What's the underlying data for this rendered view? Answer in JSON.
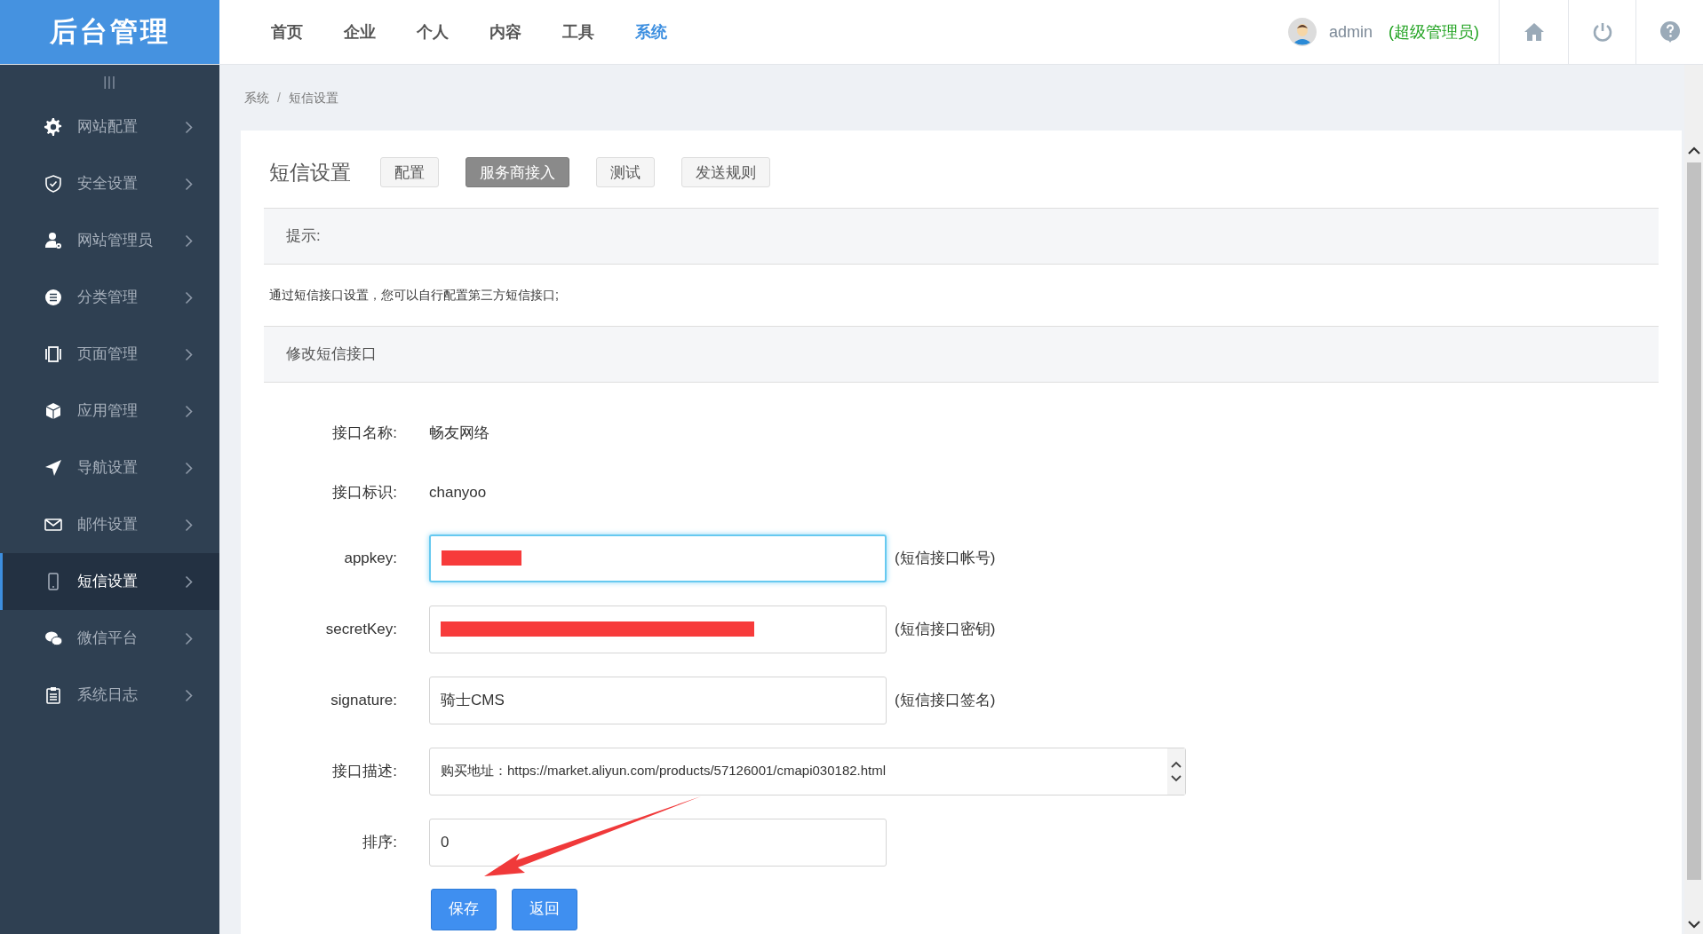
{
  "logo": "后台管理",
  "sidebar_toggle": "|||",
  "top_nav": [
    {
      "label": "首页",
      "selected": false
    },
    {
      "label": "企业",
      "selected": false
    },
    {
      "label": "个人",
      "selected": false
    },
    {
      "label": "内容",
      "selected": false
    },
    {
      "label": "工具",
      "selected": false
    },
    {
      "label": "系统",
      "selected": true
    }
  ],
  "user": {
    "name": "admin",
    "role": "(超级管理员)"
  },
  "sidebar": {
    "items": [
      {
        "label": "网站配置",
        "selected": false
      },
      {
        "label": "安全设置",
        "selected": false
      },
      {
        "label": "网站管理员",
        "selected": false
      },
      {
        "label": "分类管理",
        "selected": false
      },
      {
        "label": "页面管理",
        "selected": false
      },
      {
        "label": "应用管理",
        "selected": false
      },
      {
        "label": "导航设置",
        "selected": false
      },
      {
        "label": "邮件设置",
        "selected": false
      },
      {
        "label": "短信设置",
        "selected": true
      },
      {
        "label": "微信平台",
        "selected": false
      },
      {
        "label": "系统日志",
        "selected": false
      }
    ]
  },
  "breadcrumb": [
    "系统",
    "短信设置"
  ],
  "breadcrumb_separator": "/",
  "page_title": "短信设置",
  "tabs": [
    {
      "label": "配置",
      "selected": false
    },
    {
      "label": "服务商接入",
      "selected": true
    },
    {
      "label": "测试",
      "selected": false
    },
    {
      "label": "发送规则",
      "selected": false
    }
  ],
  "tip": {
    "title": "提示:",
    "text": "通过短信接口设置，您可以自行配置第三方短信接口;"
  },
  "form": {
    "title": "修改短信接口",
    "fields": [
      {
        "kind": "text",
        "label": "接口名称:",
        "value": "畅友网络"
      },
      {
        "kind": "text",
        "label": "接口标识:",
        "value": "chanyoo"
      },
      {
        "kind": "key",
        "label": "appkey:",
        "focused": true,
        "note": "(短信接口帐号)"
      },
      {
        "kind": "secret",
        "label": "secretKey:",
        "focused": false,
        "note": "(短信接口密钥)"
      },
      {
        "kind": "input",
        "label": "signature:",
        "value": "骑士CMS",
        "focused": false,
        "note": "(短信接口签名)"
      },
      {
        "kind": "textarea",
        "label": "接口描述:",
        "value": "购买地址：https://market.aliyun.com/products/57126001/cmapi030182.html"
      },
      {
        "kind": "input",
        "label": "排序:",
        "value": "0",
        "focused": false
      }
    ],
    "buttons": [
      "保存",
      "返回"
    ]
  }
}
